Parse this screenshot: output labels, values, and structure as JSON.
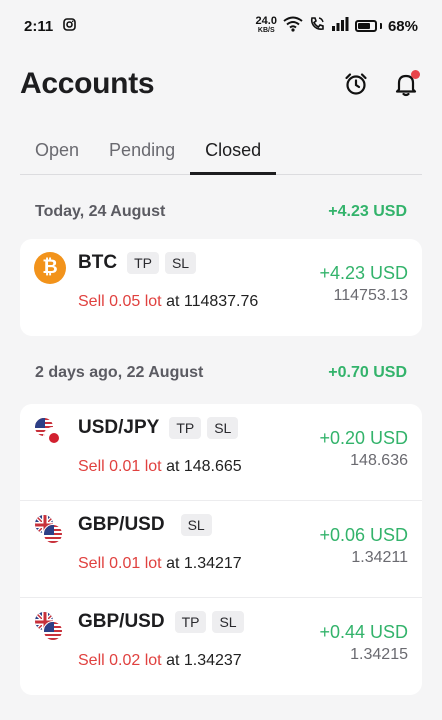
{
  "status_bar": {
    "time": "2:11",
    "net_speed_value": "24.0",
    "net_speed_unit": "KB/S",
    "battery": "68%"
  },
  "header": {
    "title": "Accounts"
  },
  "tabs": [
    {
      "label": "Open",
      "active": false
    },
    {
      "label": "Pending",
      "active": false
    },
    {
      "label": "Closed",
      "active": true
    }
  ],
  "groups": [
    {
      "date": "Today, 24 August",
      "total": "+4.23 USD",
      "trades": [
        {
          "symbol": "BTC",
          "tags": [
            "TP",
            "SL"
          ],
          "side_qty": "Sell 0.05 lot",
          "at_price": "at 114837.76",
          "pnl": "+4.23 USD",
          "close_price": "114753.13",
          "icon": "bitcoin-icon"
        }
      ]
    },
    {
      "date": "2 days ago, 22 August",
      "total": "+0.70 USD",
      "trades": [
        {
          "symbol": "USD/JPY",
          "tags": [
            "TP",
            "SL"
          ],
          "side_qty": "Sell 0.01 lot",
          "at_price": "at 148.665",
          "pnl": "+0.20 USD",
          "close_price": "148.636",
          "icon": "usd-jpy-flags-icon"
        },
        {
          "symbol": "GBP/USD",
          "tags": [
            "SL"
          ],
          "side_qty": "Sell 0.01 lot",
          "at_price": "at 1.34217",
          "pnl": "+0.06 USD",
          "close_price": "1.34211",
          "icon": "gbp-usd-flags-icon"
        },
        {
          "symbol": "GBP/USD",
          "tags": [
            "TP",
            "SL"
          ],
          "side_qty": "Sell 0.02 lot",
          "at_price": "at 1.34237",
          "pnl": "+0.44 USD",
          "close_price": "1.34215",
          "icon": "gbp-usd-flags-icon"
        }
      ]
    }
  ],
  "colors": {
    "positive": "#33b36b",
    "sell": "#e0413f",
    "notification_dot": "#e8444b",
    "btc": "#f2931b"
  }
}
